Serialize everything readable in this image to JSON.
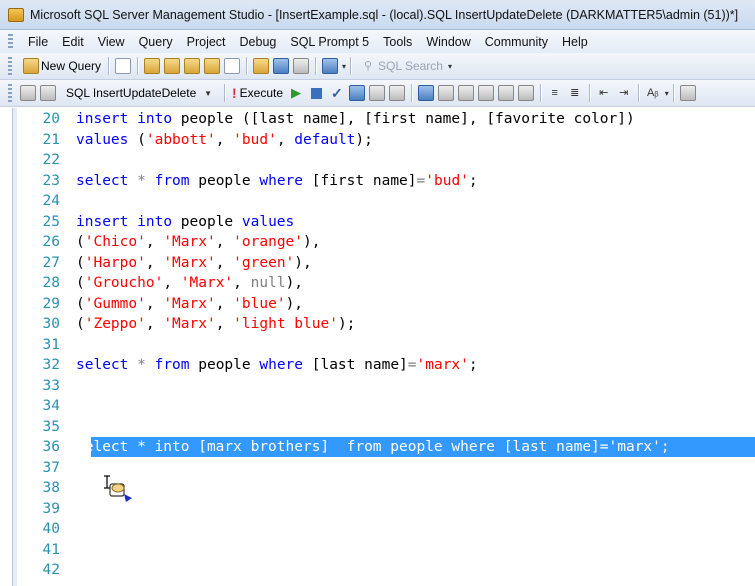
{
  "window": {
    "title": "Microsoft SQL Server Management Studio - [InsertExample.sql - (local).SQL InsertUpdateDelete (DARKMATTER5\\admin (51))*]"
  },
  "menu": {
    "items": [
      "File",
      "Edit",
      "View",
      "Query",
      "Project",
      "Debug",
      "SQL Prompt 5",
      "Tools",
      "Window",
      "Community",
      "Help"
    ]
  },
  "toolbar1": {
    "new_query_label": "New Query",
    "sql_search_label": "SQL Search"
  },
  "toolbar2": {
    "database": "SQL InsertUpdateDelete",
    "execute_label": "Execute"
  },
  "editor": {
    "lines": [
      {
        "num": "20",
        "tokens": [
          [
            "kw",
            "insert"
          ],
          [
            "id",
            " "
          ],
          [
            "kw",
            "into"
          ],
          [
            "id",
            " people ([last name], [first name], [favorite color])"
          ]
        ]
      },
      {
        "num": "21",
        "tokens": [
          [
            "kw",
            "values"
          ],
          [
            "id",
            " ("
          ],
          [
            "str",
            "'abbott'"
          ],
          [
            "id",
            ", "
          ],
          [
            "str",
            "'bud'"
          ],
          [
            "id",
            ", "
          ],
          [
            "kw",
            "default"
          ],
          [
            "id",
            ");"
          ]
        ]
      },
      {
        "num": "22",
        "tokens": []
      },
      {
        "num": "23",
        "tokens": [
          [
            "kw",
            "select"
          ],
          [
            "id",
            " "
          ],
          [
            "op",
            "*"
          ],
          [
            "id",
            " "
          ],
          [
            "kw",
            "from"
          ],
          [
            "id",
            " people "
          ],
          [
            "kw",
            "where"
          ],
          [
            "id",
            " [first name]"
          ],
          [
            "op",
            "="
          ],
          [
            "str",
            "'bud'"
          ],
          [
            "id",
            ";"
          ]
        ]
      },
      {
        "num": "24",
        "tokens": []
      },
      {
        "num": "25",
        "tokens": [
          [
            "kw",
            "insert"
          ],
          [
            "id",
            " "
          ],
          [
            "kw",
            "into"
          ],
          [
            "id",
            " people "
          ],
          [
            "kw",
            "values"
          ]
        ]
      },
      {
        "num": "26",
        "tokens": [
          [
            "id",
            "("
          ],
          [
            "str",
            "'Chico'"
          ],
          [
            "id",
            ", "
          ],
          [
            "str",
            "'Marx'"
          ],
          [
            "id",
            ", "
          ],
          [
            "str",
            "'orange'"
          ],
          [
            "id",
            "),"
          ]
        ]
      },
      {
        "num": "27",
        "tokens": [
          [
            "id",
            "("
          ],
          [
            "str",
            "'Harpo'"
          ],
          [
            "id",
            ", "
          ],
          [
            "str",
            "'Marx'"
          ],
          [
            "id",
            ", "
          ],
          [
            "str",
            "'green'"
          ],
          [
            "id",
            "),"
          ]
        ]
      },
      {
        "num": "28",
        "tokens": [
          [
            "id",
            "("
          ],
          [
            "str",
            "'Groucho'"
          ],
          [
            "id",
            ", "
          ],
          [
            "str",
            "'Marx'"
          ],
          [
            "id",
            ", "
          ],
          [
            "nul",
            "null"
          ],
          [
            "id",
            "),"
          ]
        ]
      },
      {
        "num": "29",
        "tokens": [
          [
            "id",
            "("
          ],
          [
            "str",
            "'Gummo'"
          ],
          [
            "id",
            ", "
          ],
          [
            "str",
            "'Marx'"
          ],
          [
            "id",
            ", "
          ],
          [
            "str",
            "'blue'"
          ],
          [
            "id",
            "),"
          ]
        ]
      },
      {
        "num": "30",
        "tokens": [
          [
            "id",
            "("
          ],
          [
            "str",
            "'Zeppo'"
          ],
          [
            "id",
            ", "
          ],
          [
            "str",
            "'Marx'"
          ],
          [
            "id",
            ", "
          ],
          [
            "str",
            "'light blue'"
          ],
          [
            "id",
            ");"
          ]
        ]
      },
      {
        "num": "31",
        "tokens": []
      },
      {
        "num": "32",
        "tokens": [
          [
            "kw",
            "select"
          ],
          [
            "id",
            " "
          ],
          [
            "op",
            "*"
          ],
          [
            "id",
            " "
          ],
          [
            "kw",
            "from"
          ],
          [
            "id",
            " people "
          ],
          [
            "kw",
            "where"
          ],
          [
            "id",
            " [last name]"
          ],
          [
            "op",
            "="
          ],
          [
            "str",
            "'marx'"
          ],
          [
            "id",
            ";"
          ]
        ]
      },
      {
        "num": "33",
        "tokens": []
      },
      {
        "num": "34",
        "tokens": []
      },
      {
        "num": "35",
        "tokens": []
      },
      {
        "num": "36",
        "selected": true,
        "text": "select * into [marx brothers]  from people where [last name]='marx';"
      },
      {
        "num": "37",
        "tokens": []
      },
      {
        "num": "38",
        "tokens": []
      },
      {
        "num": "39",
        "tokens": []
      },
      {
        "num": "40",
        "tokens": []
      },
      {
        "num": "41",
        "tokens": []
      },
      {
        "num": "42",
        "tokens": []
      }
    ]
  }
}
